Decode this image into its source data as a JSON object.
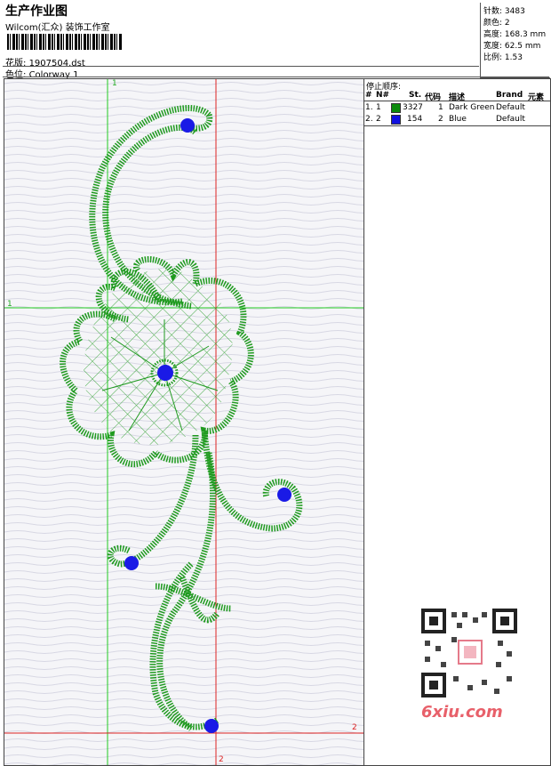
{
  "header": {
    "title": "生产作业图",
    "subtitle": "Wilcom(汇众) 装饰工作室",
    "design_label": "花版:",
    "design_value": "1907504.dst",
    "colorway_label": "色位:",
    "colorway_value": "Colorway 1"
  },
  "stats": [
    {
      "label": "针数:",
      "value": "3483"
    },
    {
      "label": "颜色:",
      "value": "2"
    },
    {
      "label": "高度:",
      "value": "168.3 mm"
    },
    {
      "label": "宽度:",
      "value": "62.5 mm"
    },
    {
      "label": "比例:",
      "value": "1.53"
    }
  ],
  "stop_sequence": {
    "title": "停止顺序:",
    "columns": {
      "num": "#",
      "no": "N#",
      "st": "St.",
      "code": "代码",
      "desc": "描述",
      "brand": "Brand",
      "element": "元素"
    },
    "rows": [
      {
        "num": "1.",
        "no": "1",
        "swatch": "#0a8a0a",
        "st": "3327",
        "code": "1",
        "desc": "Dark Green",
        "brand": "Default"
      },
      {
        "num": "2.",
        "no": "2",
        "swatch": "#1010e0",
        "st": "154",
        "code": "2",
        "desc": "Blue",
        "brand": "Default"
      }
    ]
  },
  "guides": {
    "green_v": "1",
    "green_h": "1",
    "red_v": "2",
    "red_h": "2"
  },
  "watermark": "6xiu.com",
  "colors": {
    "thread_green": "#1f9a1f",
    "thread_blue": "#1a1ae6",
    "guide_green": "#22cc22",
    "guide_red": "#dd2222"
  }
}
